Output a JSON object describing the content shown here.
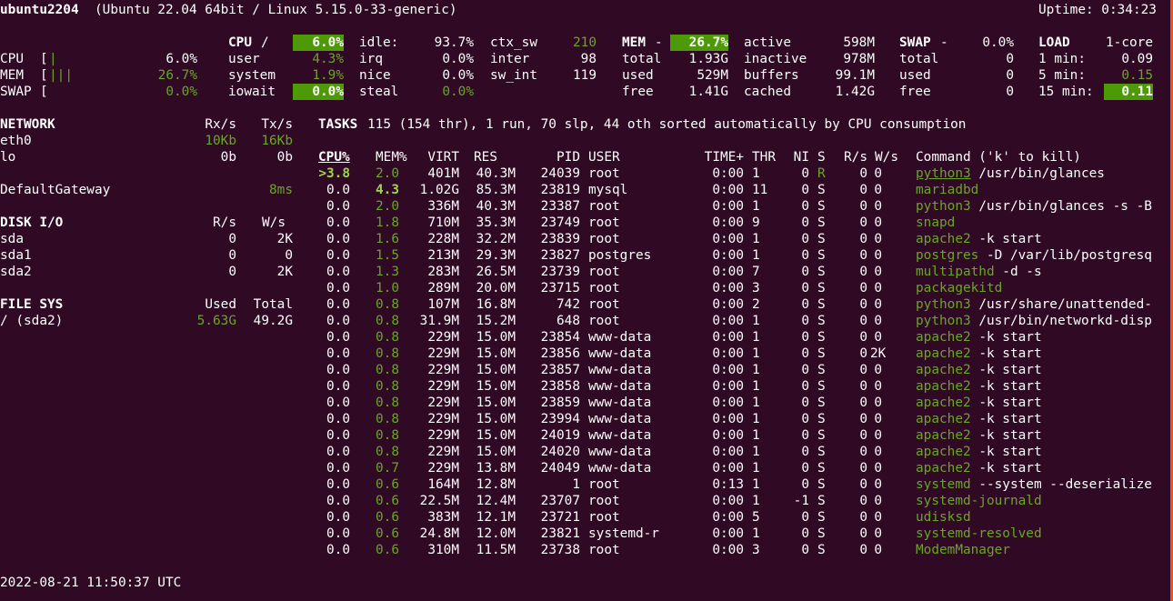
{
  "header": {
    "hostname": "ubuntu2204",
    "system": "(Ubuntu 22.04 64bit / Linux 5.15.0-33-generic)",
    "uptime": "Uptime: 0:34:23"
  },
  "quicklook": {
    "cpu": {
      "label": "CPU",
      "bar": "|",
      "pct": "6.0%"
    },
    "mem": {
      "label": "MEM",
      "bar": "|||",
      "pct": "26.7%"
    },
    "swap": {
      "label": "SWAP",
      "bar": "",
      "pct": "0.0%"
    }
  },
  "cpu": {
    "title": "CPU",
    "sep": "/",
    "total": "6.0%",
    "user_label": "user",
    "user": "4.3%",
    "system_label": "system",
    "system": "1.9%",
    "iowait_label": "iowait",
    "iowait": "0.0%",
    "idle_label": "idle:",
    "idle": "93.7%",
    "irq_label": "irq",
    "irq": "0.0%",
    "nice_label": "nice",
    "nice": "0.0%",
    "steal_label": "steal",
    "steal": "0.0%",
    "ctx_sw_label": "ctx_sw",
    "ctx_sw": "210",
    "inter_label": "inter",
    "inter": "98",
    "sw_int_label": "sw_int",
    "sw_int": "119"
  },
  "mem": {
    "title": "MEM",
    "sep": "-",
    "pct": "26.7%",
    "total_label": "total",
    "total": "1.93G",
    "used_label": "used",
    "used": "529M",
    "free_label": "free",
    "free": "1.41G",
    "active_label": "active",
    "active": "598M",
    "inactive_label": "inactive",
    "inactive": "978M",
    "buffers_label": "buffers",
    "buffers": "99.1M",
    "cached_label": "cached",
    "cached": "1.42G"
  },
  "swap": {
    "title": "SWAP",
    "sep": "-",
    "pct": "0.0%",
    "total_label": "total",
    "total": "0",
    "used_label": "used",
    "used": "0",
    "free_label": "free",
    "free": "0"
  },
  "load": {
    "title": "LOAD",
    "cores": "1-core",
    "min1_label": "1 min:",
    "min1": "0.09",
    "min5_label": "5 min:",
    "min5": "0.15",
    "min15_label": "15 min:",
    "min15": "0.11"
  },
  "network": {
    "title": "NETWORK",
    "rx_header": "Rx/s",
    "tx_header": "Tx/s",
    "rows": [
      {
        "name": "eth0",
        "rx": "10Kb",
        "tx": "16Kb"
      },
      {
        "name": "lo",
        "rx": "0b",
        "tx": "0b"
      }
    ],
    "gateway_label": "DefaultGateway",
    "gateway_value": "8ms"
  },
  "disk": {
    "title": "DISK I/O",
    "r_header": "R/s",
    "w_header": "W/s",
    "rows": [
      {
        "name": "sda",
        "r": "0",
        "w": "2K"
      },
      {
        "name": "sda1",
        "r": "0",
        "w": "0"
      },
      {
        "name": "sda2",
        "r": "0",
        "w": "2K"
      }
    ]
  },
  "fs": {
    "title": "FILE SYS",
    "used_header": "Used",
    "total_header": "Total",
    "rows": [
      {
        "name": "/ (sda2)",
        "used": "5.63G",
        "total": "49.2G"
      }
    ]
  },
  "tasks": {
    "label": "TASKS",
    "summary": "115 (154 thr), 1 run, 70 slp, 44 oth sorted automatically by CPU consumption"
  },
  "process_table": {
    "headers": {
      "cpu": "CPU%",
      "mem": "MEM%",
      "virt": "VIRT",
      "res": "RES",
      "pid": "PID",
      "user": "USER",
      "time": "TIME+",
      "thr": "THR",
      "ni": "NI",
      "s": "S",
      "rs": "R/s",
      "ws": "W/s",
      "cmd": "Command ('k' to kill)"
    },
    "rows": [
      {
        "cpu": ">3.8",
        "mem": "2.0",
        "virt": "401M",
        "res": "40.3M",
        "pid": "24039",
        "user": "root",
        "time": "0:00",
        "thr": "1",
        "ni": "0",
        "s": "R",
        "rs": "0",
        "ws": "0",
        "prog": "python3",
        "args": " /usr/bin/glances"
      },
      {
        "cpu": "0.0",
        "mem": "4.3",
        "virt": "1.02G",
        "res": "85.3M",
        "pid": "23819",
        "user": "mysql",
        "time": "0:00",
        "thr": "11",
        "ni": "0",
        "s": "S",
        "rs": "0",
        "ws": "0",
        "prog": "mariadbd",
        "args": ""
      },
      {
        "cpu": "0.0",
        "mem": "2.0",
        "virt": "336M",
        "res": "40.3M",
        "pid": "23387",
        "user": "root",
        "time": "0:00",
        "thr": "1",
        "ni": "0",
        "s": "S",
        "rs": "0",
        "ws": "0",
        "prog": "python3",
        "args": " /usr/bin/glances -s -B"
      },
      {
        "cpu": "0.0",
        "mem": "1.8",
        "virt": "710M",
        "res": "35.3M",
        "pid": "23749",
        "user": "root",
        "time": "0:00",
        "thr": "9",
        "ni": "0",
        "s": "S",
        "rs": "0",
        "ws": "0",
        "prog": "snapd",
        "args": ""
      },
      {
        "cpu": "0.0",
        "mem": "1.6",
        "virt": "228M",
        "res": "32.2M",
        "pid": "23839",
        "user": "root",
        "time": "0:00",
        "thr": "1",
        "ni": "0",
        "s": "S",
        "rs": "0",
        "ws": "0",
        "prog": "apache2",
        "args": " -k start"
      },
      {
        "cpu": "0.0",
        "mem": "1.5",
        "virt": "213M",
        "res": "29.3M",
        "pid": "23827",
        "user": "postgres",
        "time": "0:00",
        "thr": "1",
        "ni": "0",
        "s": "S",
        "rs": "0",
        "ws": "0",
        "prog": "postgres",
        "args": " -D /var/lib/postgresq"
      },
      {
        "cpu": "0.0",
        "mem": "1.3",
        "virt": "283M",
        "res": "26.5M",
        "pid": "23739",
        "user": "root",
        "time": "0:00",
        "thr": "7",
        "ni": "0",
        "s": "S",
        "rs": "0",
        "ws": "0",
        "prog": "multipathd",
        "args": " -d -s"
      },
      {
        "cpu": "0.0",
        "mem": "1.0",
        "virt": "289M",
        "res": "20.0M",
        "pid": "23715",
        "user": "root",
        "time": "0:00",
        "thr": "3",
        "ni": "0",
        "s": "S",
        "rs": "0",
        "ws": "0",
        "prog": "packagekitd",
        "args": ""
      },
      {
        "cpu": "0.0",
        "mem": "0.8",
        "virt": "107M",
        "res": "16.8M",
        "pid": "742",
        "user": "root",
        "time": "0:00",
        "thr": "2",
        "ni": "0",
        "s": "S",
        "rs": "0",
        "ws": "0",
        "prog": "python3",
        "args": " /usr/share/unattended-"
      },
      {
        "cpu": "0.0",
        "mem": "0.8",
        "virt": "31.9M",
        "res": "15.2M",
        "pid": "648",
        "user": "root",
        "time": "0:00",
        "thr": "1",
        "ni": "0",
        "s": "S",
        "rs": "0",
        "ws": "0",
        "prog": "python3",
        "args": " /usr/bin/networkd-disp"
      },
      {
        "cpu": "0.0",
        "mem": "0.8",
        "virt": "229M",
        "res": "15.0M",
        "pid": "23854",
        "user": "www-data",
        "time": "0:00",
        "thr": "1",
        "ni": "0",
        "s": "S",
        "rs": "0",
        "ws": "0",
        "prog": "apache2",
        "args": " -k start"
      },
      {
        "cpu": "0.0",
        "mem": "0.8",
        "virt": "229M",
        "res": "15.0M",
        "pid": "23856",
        "user": "www-data",
        "time": "0:00",
        "thr": "1",
        "ni": "0",
        "s": "S",
        "rs": "0",
        "ws": "2K",
        "prog": "apache2",
        "args": " -k start"
      },
      {
        "cpu": "0.0",
        "mem": "0.8",
        "virt": "229M",
        "res": "15.0M",
        "pid": "23857",
        "user": "www-data",
        "time": "0:00",
        "thr": "1",
        "ni": "0",
        "s": "S",
        "rs": "0",
        "ws": "0",
        "prog": "apache2",
        "args": " -k start"
      },
      {
        "cpu": "0.0",
        "mem": "0.8",
        "virt": "229M",
        "res": "15.0M",
        "pid": "23858",
        "user": "www-data",
        "time": "0:00",
        "thr": "1",
        "ni": "0",
        "s": "S",
        "rs": "0",
        "ws": "0",
        "prog": "apache2",
        "args": " -k start"
      },
      {
        "cpu": "0.0",
        "mem": "0.8",
        "virt": "229M",
        "res": "15.0M",
        "pid": "23859",
        "user": "www-data",
        "time": "0:00",
        "thr": "1",
        "ni": "0",
        "s": "S",
        "rs": "0",
        "ws": "0",
        "prog": "apache2",
        "args": " -k start"
      },
      {
        "cpu": "0.0",
        "mem": "0.8",
        "virt": "229M",
        "res": "15.0M",
        "pid": "23994",
        "user": "www-data",
        "time": "0:00",
        "thr": "1",
        "ni": "0",
        "s": "S",
        "rs": "0",
        "ws": "0",
        "prog": "apache2",
        "args": " -k start"
      },
      {
        "cpu": "0.0",
        "mem": "0.8",
        "virt": "229M",
        "res": "15.0M",
        "pid": "24019",
        "user": "www-data",
        "time": "0:00",
        "thr": "1",
        "ni": "0",
        "s": "S",
        "rs": "0",
        "ws": "0",
        "prog": "apache2",
        "args": " -k start"
      },
      {
        "cpu": "0.0",
        "mem": "0.8",
        "virt": "229M",
        "res": "15.0M",
        "pid": "24020",
        "user": "www-data",
        "time": "0:00",
        "thr": "1",
        "ni": "0",
        "s": "S",
        "rs": "0",
        "ws": "0",
        "prog": "apache2",
        "args": " -k start"
      },
      {
        "cpu": "0.0",
        "mem": "0.7",
        "virt": "229M",
        "res": "13.8M",
        "pid": "24049",
        "user": "www-data",
        "time": "0:00",
        "thr": "1",
        "ni": "0",
        "s": "S",
        "rs": "0",
        "ws": "0",
        "prog": "apache2",
        "args": " -k start"
      },
      {
        "cpu": "0.0",
        "mem": "0.6",
        "virt": "164M",
        "res": "12.8M",
        "pid": "1",
        "user": "root",
        "time": "0:13",
        "thr": "1",
        "ni": "0",
        "s": "S",
        "rs": "0",
        "ws": "0",
        "prog": "systemd",
        "args": " --system --deserialize"
      },
      {
        "cpu": "0.0",
        "mem": "0.6",
        "virt": "22.5M",
        "res": "12.4M",
        "pid": "23707",
        "user": "root",
        "time": "0:00",
        "thr": "1",
        "ni": "-1",
        "s": "S",
        "rs": "0",
        "ws": "0",
        "prog": "systemd-journald",
        "args": ""
      },
      {
        "cpu": "0.0",
        "mem": "0.6",
        "virt": "383M",
        "res": "12.1M",
        "pid": "23721",
        "user": "root",
        "time": "0:00",
        "thr": "5",
        "ni": "0",
        "s": "S",
        "rs": "0",
        "ws": "0",
        "prog": "udisksd",
        "args": ""
      },
      {
        "cpu": "0.0",
        "mem": "0.6",
        "virt": "24.8M",
        "res": "12.0M",
        "pid": "23821",
        "user": "systemd-r",
        "time": "0:00",
        "thr": "1",
        "ni": "0",
        "s": "S",
        "rs": "0",
        "ws": "0",
        "prog": "systemd-resolved",
        "args": ""
      },
      {
        "cpu": "0.0",
        "mem": "0.6",
        "virt": "310M",
        "res": "11.5M",
        "pid": "23738",
        "user": "root",
        "time": "0:00",
        "thr": "3",
        "ni": "0",
        "s": "S",
        "rs": "0",
        "ws": "0",
        "prog": "ModemManager",
        "args": ""
      }
    ]
  },
  "footer": {
    "datetime": "2022-08-21 11:50:37 UTC"
  },
  "colors": {
    "background": "#300a24",
    "green": "#6aa527",
    "highlight": "#4e9a06",
    "text": "#ffffff"
  }
}
